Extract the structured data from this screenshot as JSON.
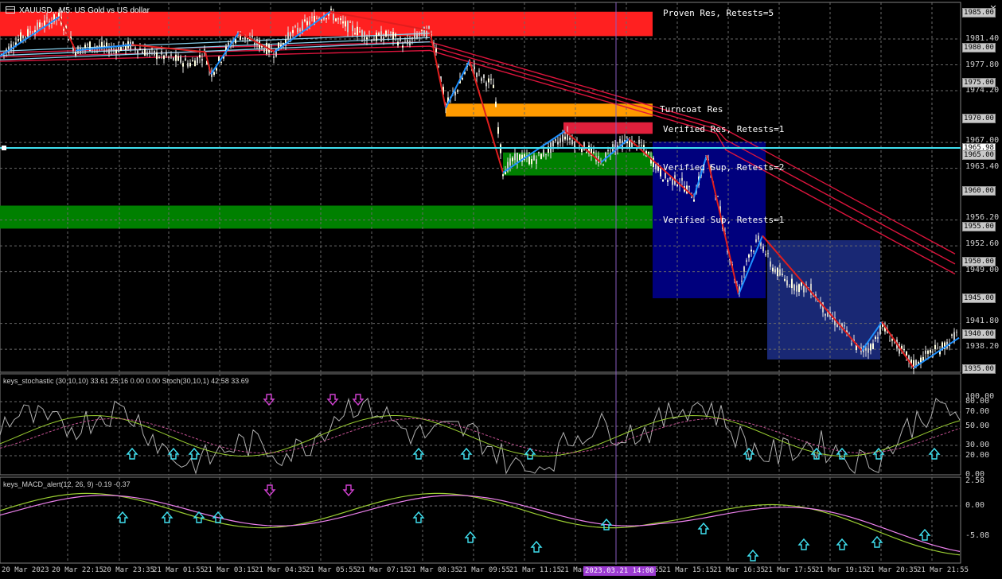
{
  "window": {
    "symbol": "XAUUSD,, M5:  US Gold vs US dollar",
    "close_icon": "close-icon",
    "menu_icon": "window-menu-icon"
  },
  "price_axis": {
    "ticks": [
      "1981.40",
      "1977.80",
      "1974.20",
      "1967.00",
      "1963.40",
      "1956.20",
      "1952.60",
      "1949.00",
      "1941.80",
      "1938.20"
    ],
    "tags": [
      "1985.00",
      "1980.00",
      "1975.00",
      "1970.00",
      "1965.98",
      "1965.00",
      "1960.00",
      "1955.00",
      "1950.00",
      "1945.00",
      "1940.00",
      "1935.00"
    ],
    "current": "1965.98"
  },
  "zones": [
    {
      "label": "Proven Res, Retests=5",
      "color": "#ff2020",
      "top": 1985.2,
      "bottom": 1981.8
    },
    {
      "label": "Turncoat Res",
      "color": "#ff9a00",
      "top": 1972.4,
      "bottom": 1970.6
    },
    {
      "label": "Verified Res, Retests=1",
      "color": "#e0203c",
      "top": 1969.8,
      "bottom": 1968.2
    },
    {
      "label": "Verified Sup, Retests=2",
      "color": "#008000",
      "top": 1965.6,
      "bottom": 1962.4
    },
    {
      "label": "Verified Sup, Retests=1",
      "color": "#008000",
      "top": 1958.2,
      "bottom": 1955.0
    }
  ],
  "stochastic": {
    "label": "keys_stochastic (30,10,10) 33.61 25.16 0.00 0.00 Stoch(30,10,1) 42.58 33.69",
    "ticks": [
      "100.00",
      "80.00",
      "70.00",
      "50.00",
      "30.00",
      "20.00",
      "0.00"
    ]
  },
  "macd": {
    "label": "keys_MACD_alert(12, 26, 9) -0.19 -0.37",
    "ticks": [
      "2.58",
      "0.00",
      "-5.08"
    ]
  },
  "time_axis": {
    "labels": [
      "20 Mar 2023",
      "20 Mar 22:15",
      "20 Mar 23:35",
      "21 Mar 01:55",
      "21 Mar 03:15",
      "21 Mar 04:35",
      "21 Mar 05:55",
      "21 Mar 07:15",
      "21 Mar 08:35",
      "21 Mar 09:55",
      "21 Mar 11:15",
      "21 Mar 12:35",
      "21 Mar 13:55",
      "21 Mar 15:15",
      "21 Mar 16:35",
      "21 Mar 17:55",
      "21 Mar 19:15",
      "21 Mar 20:35",
      "21 Mar 21:55"
    ],
    "crosshair": "2023.03.21 14:00"
  },
  "colors": {
    "zigzag_up": "#1e90ff",
    "zigzag_down": "#e01e1e",
    "ma": "#dc143c",
    "current_line": "#40e0f0",
    "box": "#00008b",
    "box2": "#1a2a7a"
  },
  "chart_data": {
    "type": "candlestick",
    "price_range": [
      1935.0,
      1986.5
    ],
    "close_path": [
      [
        0,
        1979.0
      ],
      [
        25,
        1981.5
      ],
      [
        55,
        1983.5
      ],
      [
        75,
        1984.5
      ],
      [
        95,
        1979.8
      ],
      [
        115,
        1980.5
      ],
      [
        140,
        1980.0
      ],
      [
        165,
        1980.5
      ],
      [
        185,
        1979.5
      ],
      [
        205,
        1979.0
      ],
      [
        240,
        1978.0
      ],
      [
        258,
        1979.5
      ],
      [
        265,
        1976.5
      ],
      [
        285,
        1980.0
      ],
      [
        300,
        1982.0
      ],
      [
        320,
        1981.0
      ],
      [
        345,
        1979.5
      ],
      [
        365,
        1982.0
      ],
      [
        385,
        1983.5
      ],
      [
        400,
        1984.5
      ],
      [
        415,
        1985.0
      ],
      [
        430,
        1983.5
      ],
      [
        450,
        1982.5
      ],
      [
        470,
        1981.5
      ],
      [
        490,
        1982.0
      ],
      [
        510,
        1980.5
      ],
      [
        525,
        1982.0
      ],
      [
        540,
        1982.5
      ],
      [
        548,
        1980.0
      ],
      [
        560,
        1972.0
      ],
      [
        575,
        1974.5
      ],
      [
        590,
        1978.0
      ],
      [
        605,
        1976.0
      ],
      [
        620,
        1975.0
      ],
      [
        632,
        1963.0
      ],
      [
        650,
        1965.0
      ],
      [
        670,
        1964.5
      ],
      [
        690,
        1966.0
      ],
      [
        710,
        1968.0
      ],
      [
        730,
        1966.5
      ],
      [
        740,
        1966.0
      ],
      [
        755,
        1964.0
      ],
      [
        770,
        1966.5
      ],
      [
        790,
        1967.0
      ],
      [
        805,
        1966.5
      ],
      [
        820,
        1964.5
      ],
      [
        835,
        1962.0
      ],
      [
        855,
        1961.5
      ],
      [
        872,
        1959.5
      ],
      [
        888,
        1965.0
      ],
      [
        900,
        1960.0
      ],
      [
        915,
        1952.0
      ],
      [
        928,
        1946.0
      ],
      [
        940,
        1951.5
      ],
      [
        955,
        1953.5
      ],
      [
        968,
        1950.0
      ],
      [
        985,
        1948.0
      ],
      [
        1000,
        1947.0
      ],
      [
        1020,
        1946.5
      ],
      [
        1040,
        1943.0
      ],
      [
        1060,
        1941.0
      ],
      [
        1080,
        1938.0
      ],
      [
        1095,
        1938.5
      ],
      [
        1108,
        1941.5
      ],
      [
        1125,
        1939.0
      ],
      [
        1148,
        1936.0
      ],
      [
        1165,
        1937.5
      ],
      [
        1185,
        1938.5
      ],
      [
        1205,
        1940.5
      ]
    ]
  }
}
